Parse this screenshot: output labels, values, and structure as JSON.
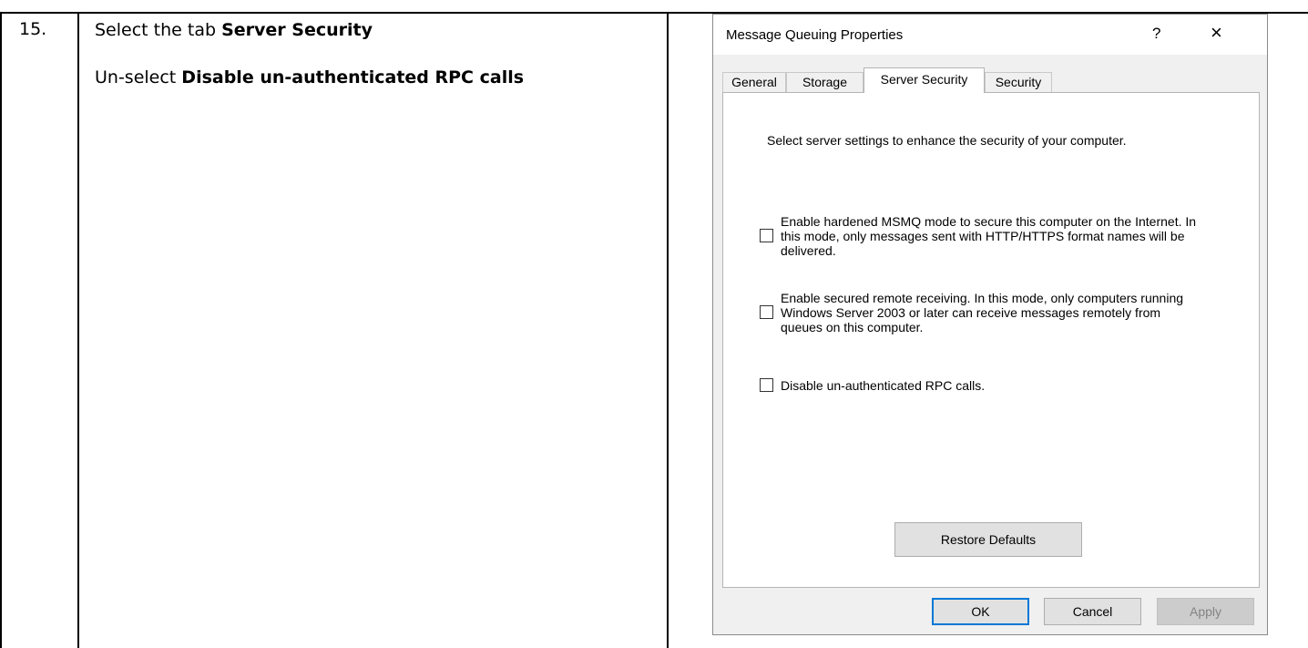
{
  "document": {
    "step_number": "15.",
    "line1_prefix": "Select the tab ",
    "line1_bold": "Server Security",
    "line2_prefix": "Un-select ",
    "line2_bold": "Disable un-authenticated RPC calls"
  },
  "dialog": {
    "title": "Message Queuing Properties",
    "help_label": "?",
    "close_label": "×",
    "tabs": [
      {
        "label": "General",
        "active": false
      },
      {
        "label": "Storage",
        "active": false
      },
      {
        "label": "Server Security",
        "active": true
      },
      {
        "label": "Security",
        "active": false
      }
    ],
    "intro": "Select server settings to enhance the security of your computer.",
    "options": [
      {
        "label": "Enable hardened MSMQ mode to secure this computer on the Internet. In this mode, only messages sent with HTTP/HTTPS format names will be delivered.",
        "checked": false
      },
      {
        "label": "Enable secured remote receiving. In this mode, only computers running Windows Server 2003 or later can receive messages remotely from queues on this computer.",
        "checked": false
      },
      {
        "label": "Disable un-authenticated RPC calls.",
        "checked": false
      }
    ],
    "restore_label": "Restore Defaults",
    "buttons": {
      "ok": "OK",
      "cancel": "Cancel",
      "apply": "Apply"
    },
    "colors": {
      "accent": "#0078d7",
      "face": "#f0f0f0"
    }
  }
}
